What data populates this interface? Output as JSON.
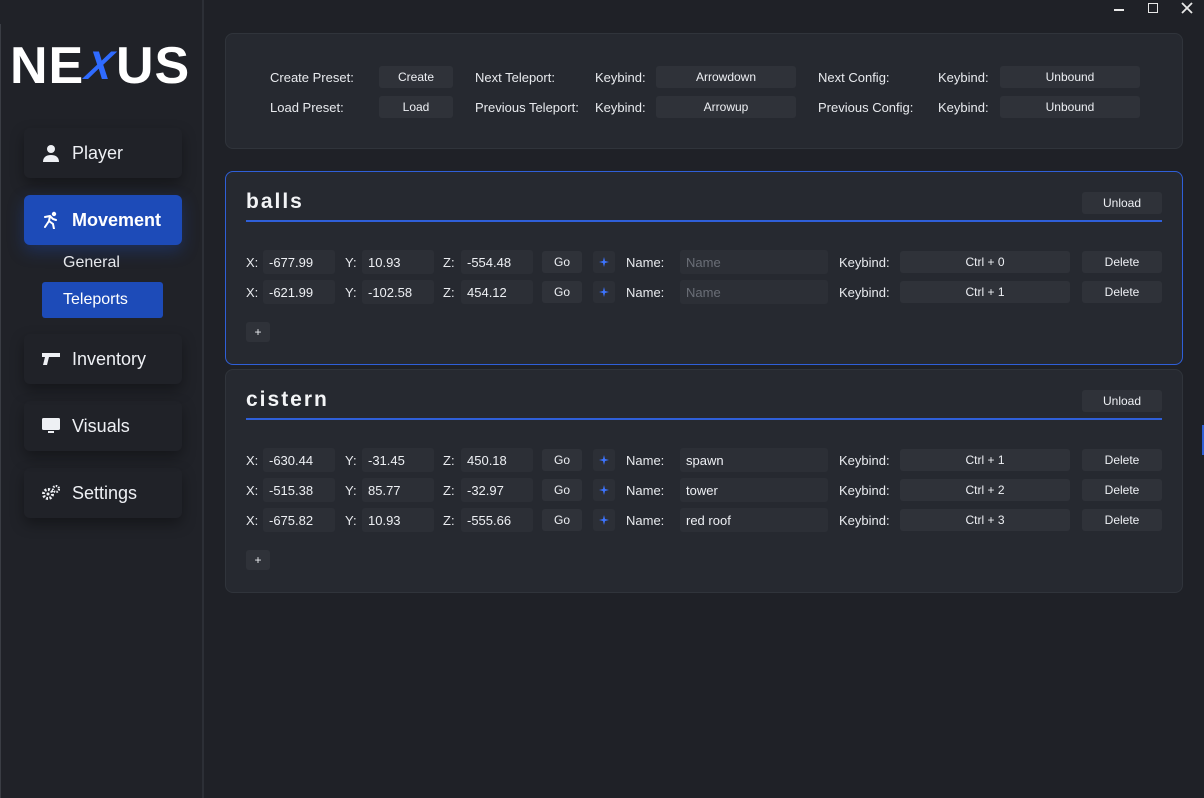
{
  "window": {
    "controls": [
      "minimize",
      "maximize",
      "close"
    ]
  },
  "logo": {
    "left": "NE",
    "mark": "X",
    "right": "US"
  },
  "sidebar": {
    "items": [
      {
        "label": "Player",
        "icon": "user-icon"
      },
      {
        "label": "Movement",
        "icon": "running-icon"
      },
      {
        "label": "Inventory",
        "icon": "gun-icon"
      },
      {
        "label": "Visuals",
        "icon": "monitor-icon"
      },
      {
        "label": "Settings",
        "icon": "gears-icon"
      }
    ],
    "subitems": [
      {
        "label": "General"
      },
      {
        "label": "Teleports"
      }
    ],
    "active_item": "Movement",
    "active_subitem": "Teleports"
  },
  "toolbar": {
    "create_preset_label": "Create Preset:",
    "create_button": "Create",
    "load_preset_label": "Load Preset:",
    "load_button": "Load",
    "next_teleport_label": "Next Teleport:",
    "previous_teleport_label": "Previous Teleport:",
    "keybind_label": "Keybind:",
    "next_teleport_keybind": "Arrowdown",
    "previous_teleport_keybind": "Arrowup",
    "next_config_label": "Next Config:",
    "previous_config_label": "Previous Config:",
    "next_config_keybind": "Unbound",
    "previous_config_keybind": "Unbound"
  },
  "labels": {
    "x": "X:",
    "y": "Y:",
    "z": "Z:",
    "go": "Go",
    "name": "Name:",
    "keybind": "Keybind:",
    "delete": "Delete",
    "unload": "Unload",
    "add": "+",
    "name_placeholder": "Name"
  },
  "presets": [
    {
      "title": "balls",
      "teleports": [
        {
          "x": "-677.99",
          "y": "10.93",
          "z": "-554.48",
          "name": "",
          "keybind": "Ctrl + 0"
        },
        {
          "x": "-621.99",
          "y": "-102.58",
          "z": "454.12",
          "name": "",
          "keybind": "Ctrl + 1"
        }
      ]
    },
    {
      "title": "cistern",
      "teleports": [
        {
          "x": "-630.44",
          "y": "-31.45",
          "z": "450.18",
          "name": "spawn",
          "keybind": "Ctrl + 1"
        },
        {
          "x": "-515.38",
          "y": "85.77",
          "z": "-32.97",
          "name": "tower",
          "keybind": "Ctrl + 2"
        },
        {
          "x": "-675.82",
          "y": "10.93",
          "z": "-555.66",
          "name": "red roof",
          "keybind": "Ctrl + 3"
        }
      ]
    }
  ],
  "colors": {
    "accent": "#1d4bb8",
    "accent_line": "#2f5fd8",
    "background": "#1f2127",
    "panel": "#262930"
  }
}
